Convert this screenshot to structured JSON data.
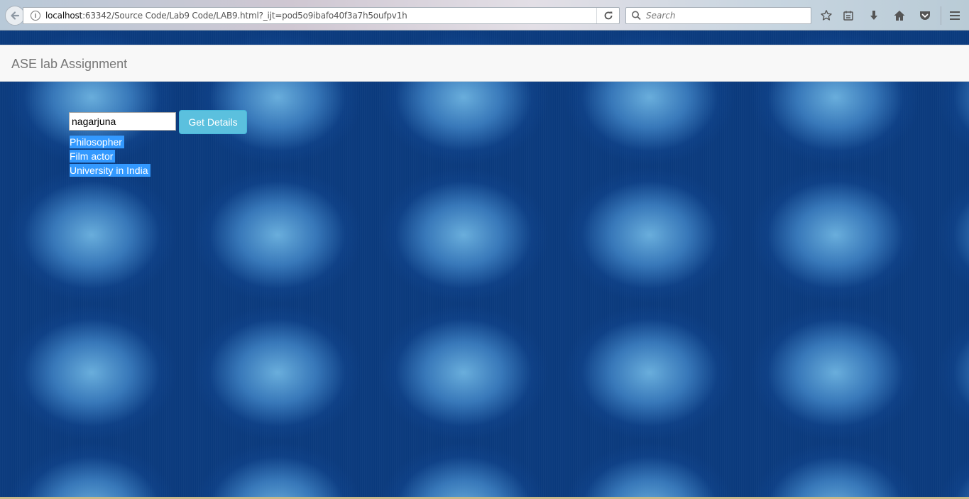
{
  "browser": {
    "url_host": "localhost",
    "url_rest": ":63342/Source Code/Lab9 Code/LAB9.html?_ijt=pod5o9ibafo40f3a7h5oufpv1h",
    "search_placeholder": "Search",
    "icons": [
      "back-arrow-icon",
      "info-icon",
      "reload-icon",
      "search-icon",
      "bookmark-star-icon",
      "reading-list-icon",
      "download-icon",
      "home-icon",
      "pocket-icon",
      "menu-icon"
    ]
  },
  "navbar": {
    "brand": "ASE lab Assignment"
  },
  "form": {
    "input_value": "nagarjuna",
    "button_label": "Get Details"
  },
  "results": [
    {
      "label": "Philosopher"
    },
    {
      "label": "Film actor"
    },
    {
      "label": "University in India"
    }
  ],
  "colors": {
    "button": "#5bc0de",
    "selection_highlight": "#3399ff",
    "background_blue": "#0a3a7e",
    "navbar": "#f8f8f8"
  }
}
